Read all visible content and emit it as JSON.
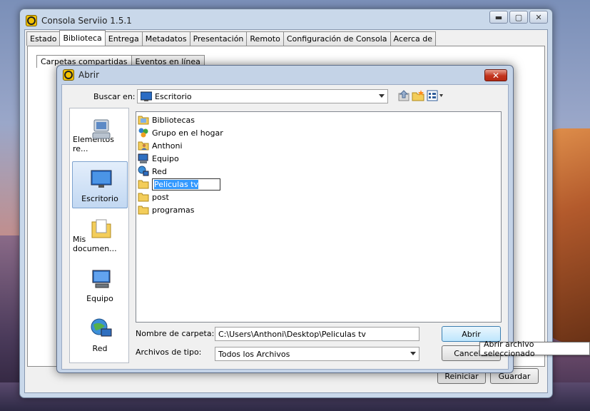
{
  "main_window": {
    "title": "Consola Serviio 1.5.1",
    "caption": {
      "minimize": "▬",
      "maximize": "▢",
      "close": "✕"
    },
    "tabs": [
      "Estado",
      "Biblioteca",
      "Entrega",
      "Metadatos",
      "Presentación",
      "Remoto",
      "Configuración de Consola",
      "Acerca de"
    ],
    "active_tab": "Biblioteca",
    "subtabs": [
      "Carpetas compartidas",
      "Eventos en línea"
    ],
    "footer": {
      "restart": "Reiniciar",
      "save": "Guardar"
    }
  },
  "dialog": {
    "title": "Abrir",
    "close": "✕",
    "look_in_label": "Buscar en:",
    "look_in_value": "Escritorio",
    "places": [
      {
        "label": "Elementos re...",
        "icon": "recent-items-icon"
      },
      {
        "label": "Escritorio",
        "icon": "desktop-icon",
        "selected": true
      },
      {
        "label": "Mis documen...",
        "icon": "documents-icon"
      },
      {
        "label": "Equipo",
        "icon": "computer-icon"
      },
      {
        "label": "Red",
        "icon": "network-icon"
      }
    ],
    "files": [
      {
        "name": "Bibliotecas",
        "icon": "libraries-icon"
      },
      {
        "name": "Grupo en el hogar",
        "icon": "homegroup-icon"
      },
      {
        "name": "Anthoni",
        "icon": "user-folder-icon"
      },
      {
        "name": "Equipo",
        "icon": "computer-icon"
      },
      {
        "name": "Red",
        "icon": "network-icon"
      },
      {
        "name": "Peliculas tv",
        "icon": "folder-icon",
        "editing": true
      },
      {
        "name": "post",
        "icon": "folder-icon"
      },
      {
        "name": "programas",
        "icon": "folder-icon"
      }
    ],
    "folder_name_label": "Nombre de carpeta:",
    "folder_name_value": "C:\\Users\\Anthoni\\Desktop\\Peliculas tv",
    "file_type_label": "Archivos de tipo:",
    "file_type_value": "Todos los Archivos",
    "open_button": "Abrir",
    "cancel_button": "Cancelar"
  },
  "tooltip": "Abrir archivo seleccionado",
  "colors": {
    "accent": "#3399ff",
    "close_red": "#c2331d",
    "app_icon": "#f2c200"
  }
}
